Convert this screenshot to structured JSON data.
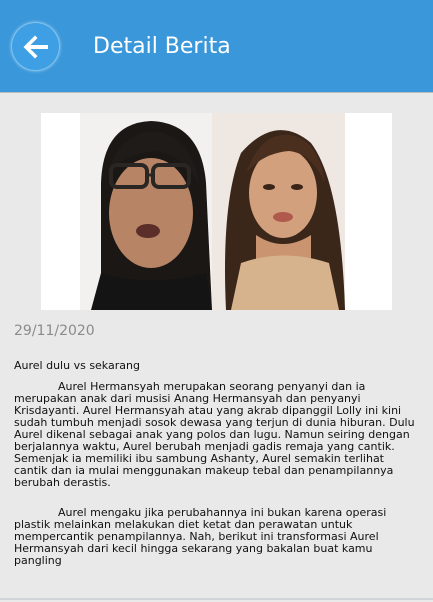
{
  "header": {
    "title": "Detail Berita",
    "back_icon": "arrow-left-icon",
    "accent": "#3a97da"
  },
  "article": {
    "date": "29/11/2020",
    "caption": "Aurel dulu vs sekarang",
    "paragraphs": [
      "Aurel Hermansyah merupakan seorang penyanyi dan ia merupakan anak dari musisi Anang Hermansyah dan penyanyi Krisdayanti. Aurel Hermansyah atau yang akrab dipanggil Lolly ini kini sudah tumbuh menjadi sosok dewasa yang terjun di dunia hiburan. Dulu Aurel dikenal sebagai anak yang polos dan lugu. Namun seiring dengan berjalannya waktu, Aurel berubah menjadi gadis remaja yang cantik. Semenjak ia memiliki ibu sambung Ashanty, Aurel semakin terlihat cantik dan ia mulai menggunakan makeup tebal dan penampilannya berubah derastis.",
      "Aurel mengaku jika perubahannya ini bukan karena operasi plastik melainkan melakukan diet ketat dan perawatan untuk mempercantik penampilannya. Nah, berikut ini transformasi Aurel Hermansyah dari kecil hingga sekarang yang bakalan buat kamu pangling"
    ]
  }
}
